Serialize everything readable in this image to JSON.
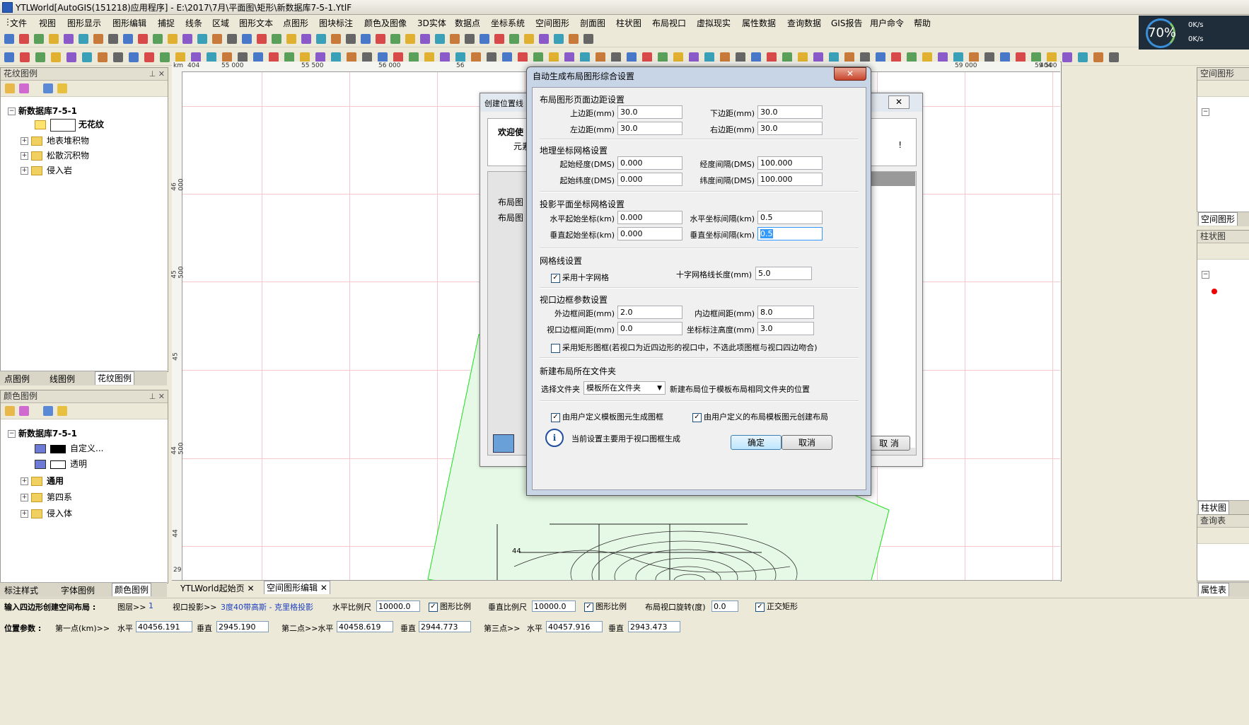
{
  "window": {
    "title": "YTLWorld[AutoGIS(151218)应用程序] - E:\\2017\\7月\\平面图\\矩形\\新数据库7-5-1.YtlF"
  },
  "menu": [
    "文件",
    "视图",
    "图形显示",
    "图形编辑",
    "捕捉",
    "线条",
    "区域",
    "图形文本",
    "点图形",
    "图块标注",
    "颜色及图像",
    "3D实体",
    "数据点",
    "坐标系统",
    "空间图形",
    "剖面图",
    "柱状图",
    "布局视口",
    "虚拟现实",
    "属性数据",
    "查询数据",
    "GIS报告",
    "用户命令",
    "帮助"
  ],
  "perf": {
    "percent": "70%",
    "up": "0K/s",
    "down": "0K/s"
  },
  "left_panel_top": {
    "title": "花纹图例",
    "root": "新数据库7-5-1",
    "items": [
      "无花纹",
      "地表堆积物",
      "松散沉积物",
      "侵入岩"
    ],
    "tabs": [
      "点图例",
      "线图例",
      "花纹图例"
    ]
  },
  "left_panel_bottom": {
    "title": "颜色图例",
    "root": "新数据库7-5-1",
    "items": [
      "自定义...",
      "透明",
      "通用",
      "第四系",
      "侵入体"
    ],
    "tabs": [
      "标注样式",
      "字体图例",
      "颜色图例"
    ]
  },
  "right_panels": {
    "p1_title": "空间图形",
    "p1_tab": "空间图形",
    "p2_title": "柱状图",
    "p2_tab": "柱状图",
    "p3_title": "查询表",
    "p3_tab": "属性表"
  },
  "ruler": {
    "h_labels": [
      "km",
      "404",
      "55 000",
      "55 500",
      "56 000",
      "56",
      "59 000",
      "59 500",
      "60 000",
      "404"
    ],
    "v_labels": [
      "46 000",
      "45 500",
      "45",
      "44 500",
      "44",
      "29"
    ]
  },
  "map_label": "44",
  "doc_tabs": [
    "YTLWorld起始页",
    "空间图形编辑"
  ],
  "status1": {
    "prompt": "输入四边形创建空间布局 :",
    "layer_label": "图层>>",
    "layer_val": "1",
    "proj_label": "视口投影>>",
    "proj_val": "3度40带高斯 - 克里格投影",
    "hscale_label": "水平比例尺",
    "hscale_val": "10000.0",
    "graph_ratio1": "图形比例",
    "vscale_label": "垂直比例尺",
    "vscale_val": "10000.0",
    "graph_ratio2": "图形比例",
    "rot_label": "布局视口旋转(度)",
    "rot_val": "0.0",
    "ortho": "正交矩形"
  },
  "status2": {
    "label": "位置参数 :",
    "p1": "第一点(km)>>",
    "h": "水平",
    "v": "垂直",
    "p1_h": "40456.191",
    "p1_v": "2945.190",
    "p2": "第二点>>水平",
    "p2_h": "40458.619",
    "p2_v": "2944.773",
    "p3": "第三点>>",
    "p3_h": "40457.916",
    "p3_v": "2943.473"
  },
  "bg_dialog": {
    "title": "创建位置线",
    "welcome": "欢迎使",
    "line2": "元素",
    "lbl1": "布局图",
    "lbl2": "布局图",
    "cancel": "取 消",
    "exclaim": "!"
  },
  "dialog": {
    "title": "自动生成布局图形综合设置",
    "close": "✕",
    "margins": {
      "title": "布局图形页面边距设置",
      "top_l": "上边距(mm)",
      "top": "30.0",
      "bottom_l": "下边距(mm)",
      "bottom": "30.0",
      "left_l": "左边距(mm)",
      "left": "30.0",
      "right_l": "右边距(mm)",
      "right": "30.0"
    },
    "geo": {
      "title": "地理坐标网格设置",
      "lon_l": "起始经度(DMS)",
      "lon": "0.000",
      "lonint_l": "经度间隔(DMS)",
      "lonint": "100.000",
      "lat_l": "起始纬度(DMS)",
      "lat": "0.000",
      "latint_l": "纬度间隔(DMS)",
      "latint": "100.000"
    },
    "proj": {
      "title": "投影平面坐标网格设置",
      "hs_l": "水平起始坐标(km)",
      "hs": "0.000",
      "hi_l": "水平坐标间隔(km)",
      "hi": "0.5",
      "vs_l": "垂直起始坐标(km)",
      "vs": "0.000",
      "vi_l": "垂直坐标间隔(km)",
      "vi": "0.5"
    },
    "gridline": {
      "title": "网格线设置",
      "cross": "采用十字网格",
      "len_l": "十字网格线长度(mm)",
      "len": "5.0"
    },
    "frame": {
      "title": "视口边框参数设置",
      "outer_l": "外边框间距(mm)",
      "outer": "2.0",
      "inner_l": "内边框间距(mm)",
      "inner": "8.0",
      "vp_l": "视口边框间距(mm)",
      "vp": "0.0",
      "lab_l": "坐标标注高度(mm)",
      "lab": "3.0",
      "rect": "采用矩形图框(若视口为近四边形的视口中，不选此项图框与视口四边吻合)"
    },
    "folder": {
      "title": "新建布局所在文件夹",
      "sel_l": "选择文件夹",
      "sel": "模板所在文件夹",
      "note": "新建布局位于模板布局相同文件夹的位置"
    },
    "opt1": "由用户定义模板图元生成图框",
    "opt2": "由用户定义的布局模板图元创建布局",
    "info": "当前设置主要用于视口图框生成",
    "ok": "确定",
    "cancel": "取消"
  },
  "colors": {
    "accent": "#3c7fb1",
    "grid": "#f4c8cc",
    "green_poly": "#19e019"
  }
}
